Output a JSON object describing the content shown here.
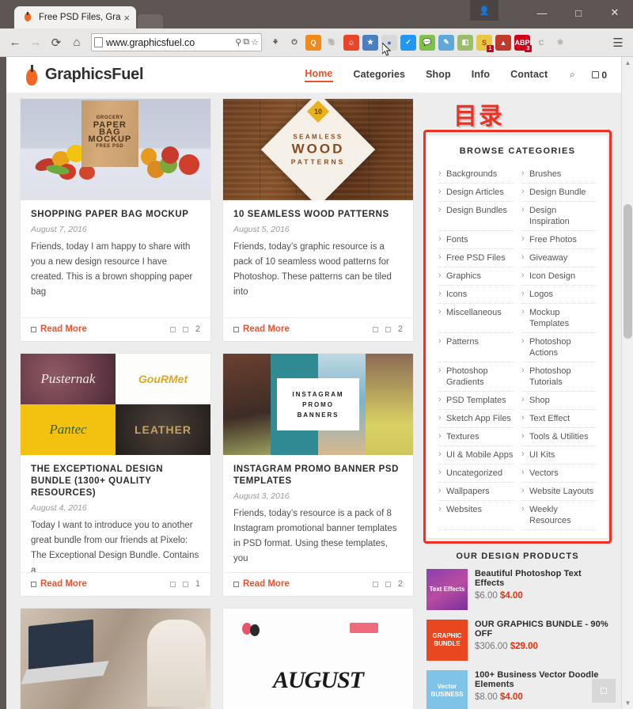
{
  "browser": {
    "tab": {
      "title": "Free PSD Files, Gra",
      "close": "×",
      "favicon": "graphicsfuel-favicon"
    },
    "window": {
      "minimize": "—",
      "maximize": "□",
      "close": "✕",
      "profile": "👤"
    },
    "nav": {
      "back": "←",
      "forward": "→",
      "reload": "⟳",
      "home": "⌂",
      "url": "www.graphicsfuel.co",
      "url_zoom_icon": "⚲",
      "url_translate_icon": "⧉",
      "url_star_icon": "☆",
      "menu": "☰"
    },
    "extensions": [
      {
        "name": "pocket-extension",
        "glyph": "⚘",
        "color": "#e9e7e5",
        "text": "#444"
      },
      {
        "name": "power-extension",
        "glyph": "⏻",
        "color": "#e9e7e5",
        "text": "#444"
      },
      {
        "name": "quantum-extension",
        "glyph": "Q",
        "color": "#f08a1a",
        "text": "#fff"
      },
      {
        "name": "evernote-extension",
        "glyph": "🐘",
        "color": "#e9e7e5",
        "text": "#666"
      },
      {
        "name": "smiley-extension",
        "glyph": "☺",
        "color": "#e8462a",
        "text": "#fff"
      },
      {
        "name": "bookmark-star-extension",
        "glyph": "★",
        "color": "#4a7fc1",
        "text": "#fff"
      },
      {
        "name": "blue-dot-extension",
        "glyph": "●",
        "color": "#d8d8d8",
        "text": "#2b6fd4"
      },
      {
        "name": "check-shield-extension",
        "glyph": "✓",
        "color": "#2196f3",
        "text": "#fff"
      },
      {
        "name": "wechat-extension",
        "glyph": "💬",
        "color": "#7ec04a",
        "text": "#fff"
      },
      {
        "name": "globe-pen-extension",
        "glyph": "✎",
        "color": "#5fa9d8",
        "text": "#fff"
      },
      {
        "name": "map-extension",
        "glyph": "◧",
        "color": "#9dbd6a",
        "text": "#fff"
      },
      {
        "name": "snagit-extension",
        "glyph": "S",
        "color": "#e8c840",
        "text": "#c0392b",
        "badge": "1"
      },
      {
        "name": "acrobat-extension",
        "glyph": "▲",
        "color": "#c0392b",
        "text": "#fff"
      },
      {
        "name": "adblock-extension",
        "glyph": "ABP",
        "color": "#d0021b",
        "text": "#fff",
        "badge": "3"
      },
      {
        "name": "c-extension",
        "glyph": "C",
        "color": "#e9e7e5",
        "text": "#aaa"
      },
      {
        "name": "leaf-extension",
        "glyph": "❀",
        "color": "#e9e7e5",
        "text": "#b0b0b0"
      }
    ]
  },
  "site": {
    "logo": "GraphicsFuel",
    "nav": [
      {
        "label": "Home",
        "active": true
      },
      {
        "label": "Categories",
        "active": false
      },
      {
        "label": "Shop",
        "active": false
      },
      {
        "label": "Info",
        "active": false
      },
      {
        "label": "Contact",
        "active": false
      }
    ],
    "search_icon": "⌕",
    "cart_count": "0"
  },
  "annotation": {
    "text": "目录",
    "color": "#ee3124"
  },
  "posts": [
    {
      "title": "SHOPPING PAPER BAG MOCKUP",
      "date": "August 7, 2016",
      "excerpt": "Friends, today I am happy to share with you a new design resource I have created. This is a brown shopping paper bag",
      "read_more": "Read More",
      "comments": "2",
      "image_name": "grocery-paper-bag-mockup-image",
      "image_text": {
        "line1": "GROCERY",
        "line2": "PAPER BAG",
        "line3": "MOCKUP",
        "line4": "FREE PSD"
      }
    },
    {
      "title": "10 SEAMLESS WOOD PATTERNS",
      "date": "August 5, 2016",
      "excerpt": "Friends, today’s graphic resource is a pack of 10 seamless wood patterns for Photoshop. These patterns can be tiled into",
      "read_more": "Read More",
      "comments": "2",
      "image_name": "seamless-wood-patterns-image",
      "image_text": {
        "badge": "10",
        "line1": "SEAMLESS",
        "line2": "WOOD",
        "line3": "PATTERNS"
      }
    },
    {
      "title": "THE EXCEPTIONAL DESIGN BUNDLE (1300+ QUALITY RESOURCES)",
      "date": "August 4, 2016",
      "excerpt": "Today I want to introduce you to another great bundle from our friends at Pixelo: The Exceptional Design Bundle. Contains a",
      "read_more": "Read More",
      "comments": "1",
      "image_name": "exceptional-design-bundle-image",
      "image_text": {
        "q1": "Pusternak",
        "q2": "GouRMet",
        "q3": "Pantec",
        "q4": "LEATHER"
      }
    },
    {
      "title": "INSTAGRAM PROMO BANNER PSD TEMPLATES",
      "date": "August 3, 2016",
      "excerpt": "Friends, today’s resource is a pack of 8 Instagram promotional banner templates in PSD format. Using these templates, you",
      "read_more": "Read More",
      "comments": "2",
      "image_name": "instagram-promo-banners-image",
      "image_text": {
        "line1": "INSTAGRAM",
        "line2": "PROMO",
        "line3": "BANNERS"
      }
    },
    {
      "image_name": "laptop-workspace-image",
      "image_text": {}
    },
    {
      "image_name": "august-lettering-image",
      "image_text": {
        "word": "AUGUST"
      }
    }
  ],
  "sidebar": {
    "categories_title": "BROWSE CATEGORIES",
    "categories": [
      "Backgrounds",
      "Brushes",
      "Design Articles",
      "Design Bundle",
      "Design Bundles",
      "Design Inspiration",
      "Fonts",
      "Free Photos",
      "Free PSD Files",
      "Giveaway",
      "Graphics",
      "Icon Design",
      "Icons",
      "Logos",
      "Miscellaneous",
      "Mockup Templates",
      "Patterns",
      "Photoshop Actions",
      "Photoshop Gradients",
      "Photoshop Tutorials",
      "PSD Templates",
      "Shop",
      "Sketch App Files",
      "Text Effect",
      "Textures",
      "Tools & Utilities",
      "UI & Mobile Apps",
      "UI Kits",
      "Uncategorized",
      "Vectors",
      "Wallpapers",
      "Website Layouts",
      "Websites",
      "Weekly Resources"
    ],
    "products_title": "OUR DESIGN PRODUCTS",
    "products": [
      {
        "name": "Beautiful Photoshop Text Effects",
        "price_old": "$6.00",
        "price_new": "$4.00",
        "thumb_name": "text-effects-thumb",
        "thumb_text": "Text Effects"
      },
      {
        "name": "OUR GRAPHICS BUNDLE - 90% OFF",
        "price_old": "$306.00",
        "price_new": "$29.00",
        "thumb_name": "graphics-bundle-thumb",
        "thumb_text": "GRAPHIC BUNDLE"
      },
      {
        "name": "100+ Business Vector Doodle Elements",
        "price_old": "$8.00",
        "price_new": "$4.00",
        "thumb_name": "business-vector-thumb",
        "thumb_text": "Vector BUSINESS"
      }
    ]
  },
  "scroll": {
    "up_arrow": "▲",
    "down_arrow": "▼",
    "to_top": "□"
  }
}
